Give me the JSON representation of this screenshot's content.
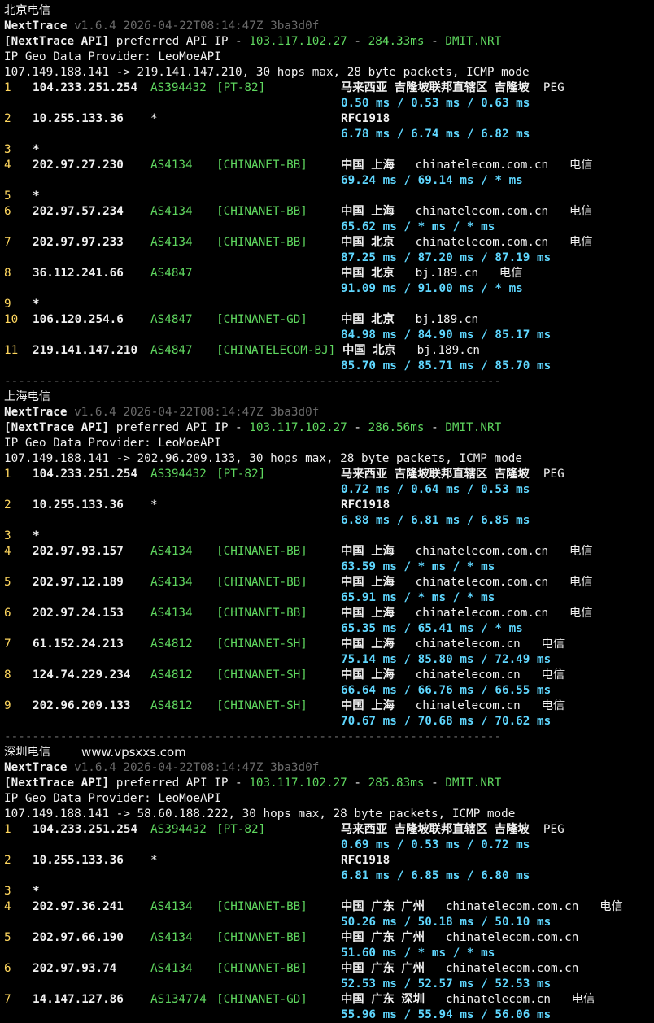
{
  "watermark": "www.vpsxxs.com",
  "separator": "-----------------------------------------------------------------------",
  "colors": {
    "background": "#000000",
    "hop_number": "#ffd75f",
    "asn": "#5fd75f",
    "latency": "#5fd7ff",
    "version": "#6b6b6b"
  },
  "sections": [
    {
      "title": "北京电信",
      "app_name": "NextTrace",
      "version_line": "v1.6.4 2026-04-22T08:14:47Z 3ba3d0f",
      "api_label": "[NextTrace API]",
      "api_text": "preferred API IP - ",
      "api_ip": "103.117.102.27",
      "api_sep": " - ",
      "api_latency": "284.33ms",
      "api_sep2": " - ",
      "api_node": "DMIT.NRT",
      "geo_provider": "IP Geo Data Provider: LeoMoeAPI",
      "route": "107.149.188.141 -> 219.141.147.210, 30 hops max, 28 byte packets, ICMP mode",
      "hops": [
        {
          "num": "1",
          "ip": "104.233.251.254",
          "asn": "AS394432",
          "tag": "[PT-82]",
          "geo": "马来西亚 吉隆坡联邦直辖区 吉隆坡",
          "domain": "",
          "isp": "PEG",
          "latency": "0.50 ms / 0.53 ms / 0.63 ms"
        },
        {
          "num": "2",
          "ip": "10.255.133.36",
          "asn": "*",
          "tag": "",
          "geo": "RFC1918",
          "domain": "",
          "isp": "",
          "latency": "6.78 ms / 6.74 ms / 6.82 ms"
        },
        {
          "num": "3",
          "ip": "*",
          "asn": "",
          "tag": "",
          "geo": "",
          "domain": "",
          "isp": "",
          "latency": ""
        },
        {
          "num": "4",
          "ip": "202.97.27.230",
          "asn": "AS4134",
          "tag": "[CHINANET-BB]",
          "geo": "中国 上海",
          "domain": "chinatelecom.com.cn",
          "isp": "电信",
          "latency": "69.24 ms / 69.14 ms / * ms"
        },
        {
          "num": "5",
          "ip": "*",
          "asn": "",
          "tag": "",
          "geo": "",
          "domain": "",
          "isp": "",
          "latency": ""
        },
        {
          "num": "6",
          "ip": "202.97.57.234",
          "asn": "AS4134",
          "tag": "[CHINANET-BB]",
          "geo": "中国 上海",
          "domain": "chinatelecom.com.cn",
          "isp": "电信",
          "latency": "65.62 ms / * ms / * ms"
        },
        {
          "num": "7",
          "ip": "202.97.97.233",
          "asn": "AS4134",
          "tag": "[CHINANET-BB]",
          "geo": "中国 北京",
          "domain": "chinatelecom.com.cn",
          "isp": "电信",
          "latency": "87.25 ms / 87.20 ms / 87.19 ms"
        },
        {
          "num": "8",
          "ip": "36.112.241.66",
          "asn": "AS4847",
          "tag": "",
          "geo": "中国 北京",
          "domain": "bj.189.cn",
          "isp": "电信",
          "latency": "91.09 ms / 91.00 ms / * ms"
        },
        {
          "num": "9",
          "ip": "*",
          "asn": "",
          "tag": "",
          "geo": "",
          "domain": "",
          "isp": "",
          "latency": ""
        },
        {
          "num": "10",
          "ip": "106.120.254.6",
          "asn": "AS4847",
          "tag": "[CHINANET-GD]",
          "geo": "中国 北京",
          "domain": "bj.189.cn",
          "isp": "",
          "latency": "84.98 ms / 84.90 ms / 85.17 ms"
        },
        {
          "num": "11",
          "ip": "219.141.147.210",
          "asn": "AS4847",
          "tag": "[CHINATELECOM-BJ]",
          "geo": "中国 北京",
          "domain": "bj.189.cn",
          "isp": "",
          "latency": "85.70 ms / 85.71 ms / 85.70 ms"
        }
      ]
    },
    {
      "title": "上海电信",
      "app_name": "NextTrace",
      "version_line": "v1.6.4 2026-04-22T08:14:47Z 3ba3d0f",
      "api_label": "[NextTrace API]",
      "api_text": "preferred API IP - ",
      "api_ip": "103.117.102.27",
      "api_sep": " - ",
      "api_latency": "286.56ms",
      "api_sep2": " - ",
      "api_node": "DMIT.NRT",
      "geo_provider": "IP Geo Data Provider: LeoMoeAPI",
      "route": "107.149.188.141 -> 202.96.209.133, 30 hops max, 28 byte packets, ICMP mode",
      "hops": [
        {
          "num": "1",
          "ip": "104.233.251.254",
          "asn": "AS394432",
          "tag": "[PT-82]",
          "geo": "马来西亚 吉隆坡联邦直辖区 吉隆坡",
          "domain": "",
          "isp": "PEG",
          "latency": "0.72 ms / 0.64 ms / 0.53 ms"
        },
        {
          "num": "2",
          "ip": "10.255.133.36",
          "asn": "*",
          "tag": "",
          "geo": "RFC1918",
          "domain": "",
          "isp": "",
          "latency": "6.88 ms / 6.81 ms / 6.85 ms"
        },
        {
          "num": "3",
          "ip": "*",
          "asn": "",
          "tag": "",
          "geo": "",
          "domain": "",
          "isp": "",
          "latency": ""
        },
        {
          "num": "4",
          "ip": "202.97.93.157",
          "asn": "AS4134",
          "tag": "[CHINANET-BB]",
          "geo": "中国 上海",
          "domain": "chinatelecom.com.cn",
          "isp": "电信",
          "latency": "63.59 ms / * ms / * ms"
        },
        {
          "num": "5",
          "ip": "202.97.12.189",
          "asn": "AS4134",
          "tag": "[CHINANET-BB]",
          "geo": "中国 上海",
          "domain": "chinatelecom.com.cn",
          "isp": "电信",
          "latency": "65.91 ms / * ms / * ms"
        },
        {
          "num": "6",
          "ip": "202.97.24.153",
          "asn": "AS4134",
          "tag": "[CHINANET-BB]",
          "geo": "中国 上海",
          "domain": "chinatelecom.com.cn",
          "isp": "电信",
          "latency": "65.35 ms / 65.41 ms / * ms"
        },
        {
          "num": "7",
          "ip": "61.152.24.213",
          "asn": "AS4812",
          "tag": "[CHINANET-SH]",
          "geo": "中国 上海",
          "domain": "chinatelecom.cn",
          "isp": "电信",
          "latency": "75.14 ms / 85.80 ms / 72.49 ms"
        },
        {
          "num": "8",
          "ip": "124.74.229.234",
          "asn": "AS4812",
          "tag": "[CHINANET-SH]",
          "geo": "中国 上海",
          "domain": "chinatelecom.cn",
          "isp": "电信",
          "latency": "66.64 ms / 66.76 ms / 66.55 ms"
        },
        {
          "num": "9",
          "ip": "202.96.209.133",
          "asn": "AS4812",
          "tag": "[CHINANET-SH]",
          "geo": "中国 上海",
          "domain": "chinatelecom.cn",
          "isp": "电信",
          "latency": "70.67 ms / 70.68 ms / 70.62 ms"
        }
      ]
    },
    {
      "title": "深圳电信",
      "app_name": "NextTrace",
      "version_line": "v1.6.4 2026-04-22T08:14:47Z 3ba3d0f",
      "api_label": "[NextTrace API]",
      "api_text": "preferred API IP - ",
      "api_ip": "103.117.102.27",
      "api_sep": " - ",
      "api_latency": "285.83ms",
      "api_sep2": " - ",
      "api_node": "DMIT.NRT",
      "geo_provider": "IP Geo Data Provider: LeoMoeAPI",
      "route": "107.149.188.141 -> 58.60.188.222, 30 hops max, 28 byte packets, ICMP mode",
      "hops": [
        {
          "num": "1",
          "ip": "104.233.251.254",
          "asn": "AS394432",
          "tag": "[PT-82]",
          "geo": "马来西亚 吉隆坡联邦直辖区 吉隆坡",
          "domain": "",
          "isp": "PEG",
          "latency": "0.69 ms / 0.53 ms / 0.72 ms"
        },
        {
          "num": "2",
          "ip": "10.255.133.36",
          "asn": "*",
          "tag": "",
          "geo": "RFC1918",
          "domain": "",
          "isp": "",
          "latency": "6.81 ms / 6.85 ms / 6.80 ms"
        },
        {
          "num": "3",
          "ip": "*",
          "asn": "",
          "tag": "",
          "geo": "",
          "domain": "",
          "isp": "",
          "latency": ""
        },
        {
          "num": "4",
          "ip": "202.97.36.241",
          "asn": "AS4134",
          "tag": "[CHINANET-BB]",
          "geo": "中国 广东 广州",
          "domain": "chinatelecom.com.cn",
          "isp": "电信",
          "latency": "50.26 ms / 50.18 ms / 50.10 ms"
        },
        {
          "num": "5",
          "ip": "202.97.66.190",
          "asn": "AS4134",
          "tag": "[CHINANET-BB]",
          "geo": "中国 广东 广州",
          "domain": "chinatelecom.com.cn",
          "isp": "",
          "latency": "51.60 ms / * ms / * ms"
        },
        {
          "num": "6",
          "ip": "202.97.93.74",
          "asn": "AS4134",
          "tag": "[CHINANET-BB]",
          "geo": "中国 广东 广州",
          "domain": "chinatelecom.com.cn",
          "isp": "",
          "latency": "52.53 ms / 52.57 ms / 52.53 ms"
        },
        {
          "num": "7",
          "ip": "14.147.127.86",
          "asn": "AS134774",
          "tag": "[CHINANET-GD]",
          "geo": "中国 广东 深圳",
          "domain": "chinatelecom.cn",
          "isp": "电信",
          "latency": "55.96 ms / 55.94 ms / 56.06 ms"
        }
      ]
    }
  ]
}
